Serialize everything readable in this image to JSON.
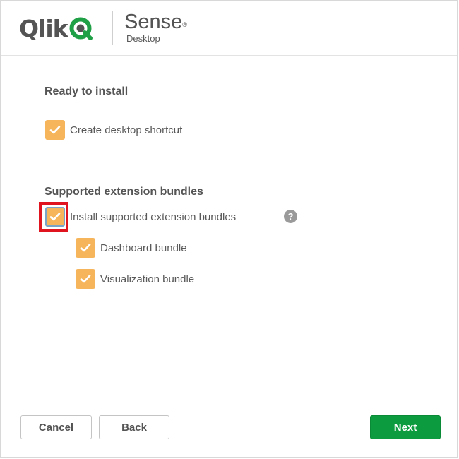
{
  "header": {
    "brand_wordmark": "Qlik",
    "product_name": "Sense",
    "product_reg": "®",
    "product_edition": "Desktop"
  },
  "install_section": {
    "title": "Ready to install",
    "create_shortcut": {
      "label": "Create desktop shortcut",
      "checked": true
    }
  },
  "extensions_section": {
    "title": "Supported extension bundles",
    "install_bundles": {
      "label": "Install supported extension bundles",
      "checked": true
    },
    "help_glyph": "?",
    "bundles": [
      {
        "label": "Dashboard bundle",
        "checked": true
      },
      {
        "label": "Visualization bundle",
        "checked": true
      }
    ]
  },
  "footer": {
    "cancel_label": "Cancel",
    "back_label": "Back",
    "next_label": "Next"
  },
  "colors": {
    "checkbox_fill": "#f6b55b",
    "primary_button": "#0c9b3f",
    "highlight": "#e0141e",
    "qlik_green": "#1fa046"
  }
}
